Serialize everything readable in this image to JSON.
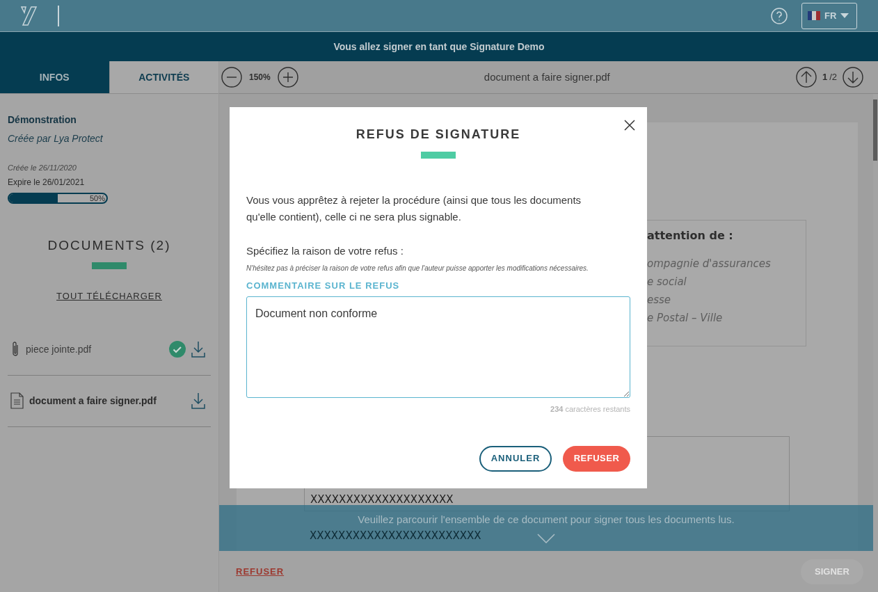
{
  "header": {
    "language": "FR"
  },
  "banner": "Vous allez signer en tant que Signature Demo",
  "tabs": [
    {
      "label": "INFOS",
      "selected": true
    },
    {
      "label": "ACTIVITÉS",
      "selected": false
    }
  ],
  "procedure": {
    "title": "Démonstration",
    "author": "Créée par Lya Protect",
    "created": "Créée le 26/11/2020",
    "expires": "Expire le 26/01/2021",
    "level": 0.5,
    "percent": "50%"
  },
  "documents": {
    "title": "DOCUMENTS (2)",
    "download_all": "TOUT TÉLÉCHARGER",
    "items": [
      {
        "kind": "attachment",
        "name": "piece jointe.pdf",
        "selected": false,
        "validated": true
      },
      {
        "kind": "document",
        "name": "document a faire signer.pdf",
        "selected": true,
        "validated": false
      }
    ]
  },
  "viewer": {
    "zoom": "150%",
    "filename": "document a faire signer.pdf",
    "page": "1",
    "pages": "/2",
    "recipient_heading": "attention de :",
    "recipient_lines": [
      "ompagnie d'assurances",
      "e social",
      "esse",
      "e Postal – Ville"
    ],
    "field_lines": [
      "XXXXXXXXXXXXXXXXXXXX",
      "XXXXXXXXXXXXXXXXXXXXXXXX"
    ]
  },
  "scroll_notice": "Veuillez parcourir l'ensemble de ce document pour signer tous les documents lus.",
  "footer": {
    "refuse": "REFUSER",
    "sign": "SIGNER",
    "sign_disabled": true
  },
  "modal": {
    "title": "REFUS DE SIGNATURE",
    "message": "Vous vous apprêtez à rejeter la procédure (ainsi que tous les documents qu'elle contient), celle ci ne sera plus signable.",
    "reason_label": "Spécifiez la raison de votre refus :",
    "hint": "N'hésitez pas à préciser la raison de votre refus afin que l'auteur puisse apporter les modifications nécessaires.",
    "field_label": "COMMENTAIRE SUR LE REFUS",
    "comment": "Document non conforme",
    "counter": "**234** caractères restants",
    "cancel": "ANNULER",
    "confirm": "REFUSER"
  }
}
